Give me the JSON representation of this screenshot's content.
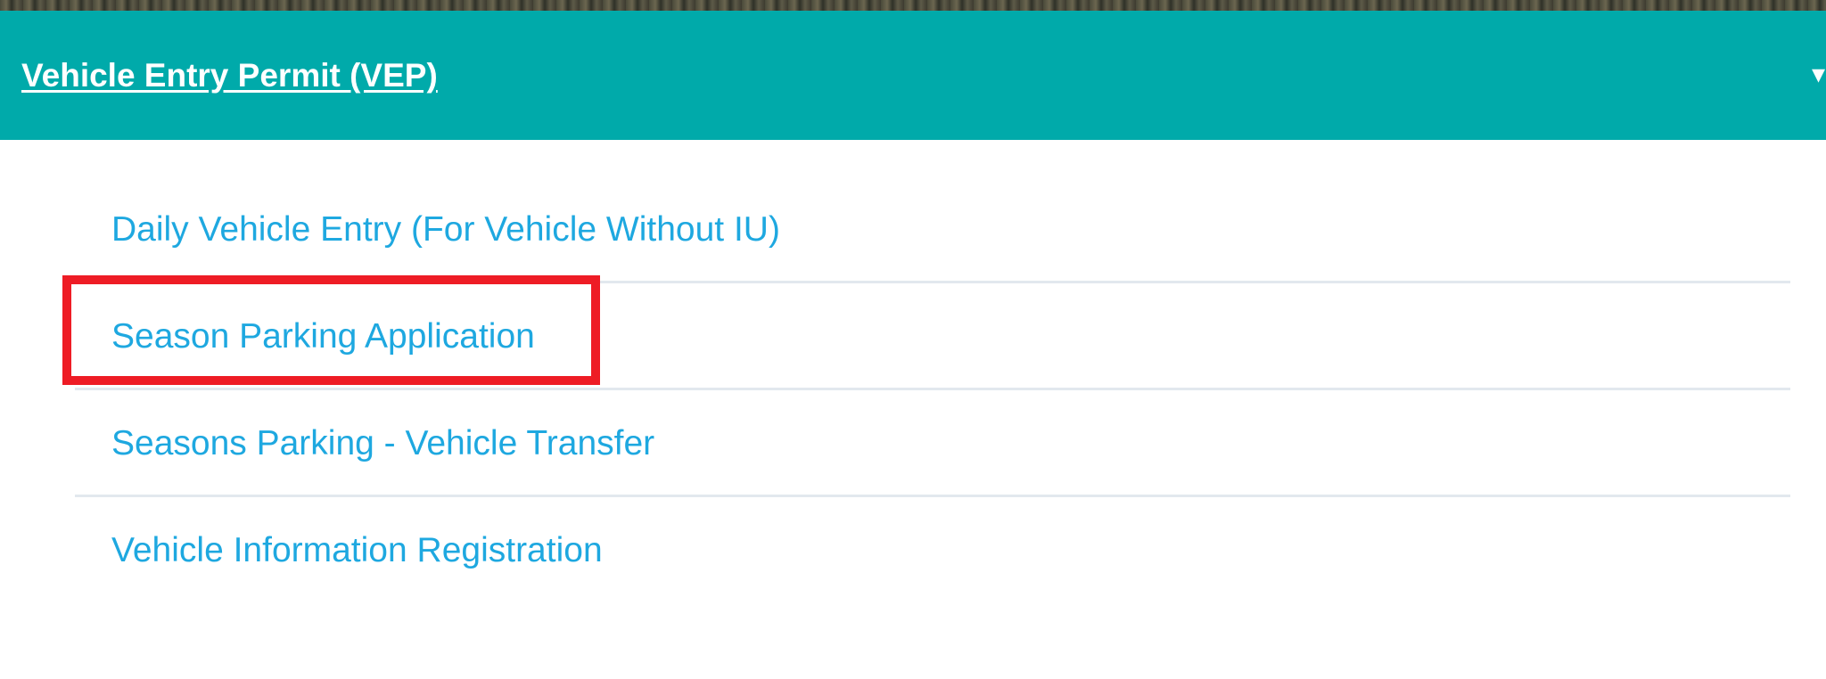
{
  "header": {
    "title": "Vehicle Entry Permit (VEP)"
  },
  "menu": {
    "items": [
      {
        "label": "Daily Vehicle Entry (For Vehicle Without IU)"
      },
      {
        "label": "Season Parking Application"
      },
      {
        "label": "Seasons Parking - Vehicle Transfer"
      },
      {
        "label": "Vehicle Information Registration"
      }
    ]
  },
  "colors": {
    "header_bg": "#00aaaa",
    "link": "#1ea8e0",
    "highlight": "#ee1c25"
  }
}
